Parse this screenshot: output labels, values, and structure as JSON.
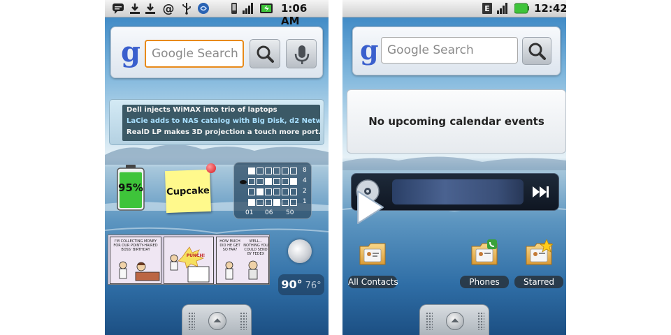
{
  "left_screen": {
    "status": {
      "time": "1:06 AM"
    },
    "search": {
      "placeholder": "Google Search"
    },
    "news": {
      "headlines": [
        "Dell injects WiMAX into trio of laptops",
        "LaCie adds to NAS catalog with Big Disk, d2 Netw…",
        "RealD LP makes 3D projection a touch more port…"
      ]
    },
    "battery": {
      "percent": "95%",
      "level": 0.95
    },
    "sticky_note": {
      "text": "Cupcake"
    },
    "stats": {
      "scale": [
        "8",
        "4",
        "2",
        "1"
      ],
      "columns": [
        "01",
        "06",
        "50"
      ]
    },
    "comic": {
      "panel1": "I'M COLLECTING MONEY FOR OUR POINTY-HAIRED BOSS' BIRTHDAY",
      "panel2": "PUNCH!",
      "panel3_a": "HOW MUCH DID HE GET SO FAR?",
      "panel3_b": "WELL... NOTHING YOU COULD SEND BY FEDEX"
    },
    "weather": {
      "high": "90°",
      "low": "76°"
    }
  },
  "right_screen": {
    "status": {
      "time": "12:42"
    },
    "search": {
      "placeholder": "Google Search"
    },
    "calendar": {
      "message": "No upcoming calendar events"
    },
    "shortcuts": [
      {
        "label": "All Contacts",
        "icon": "contacts-folder-icon"
      },
      {
        "label": "Phones",
        "icon": "phone-contacts-folder-icon"
      },
      {
        "label": "Starred",
        "icon": "starred-contacts-folder-icon"
      }
    ]
  },
  "colors": {
    "search_focus": "#e88a1a",
    "google_blue": "#3a5fcd",
    "battery_green": "#3ec43a",
    "sticky_yellow": "#fff98c"
  }
}
